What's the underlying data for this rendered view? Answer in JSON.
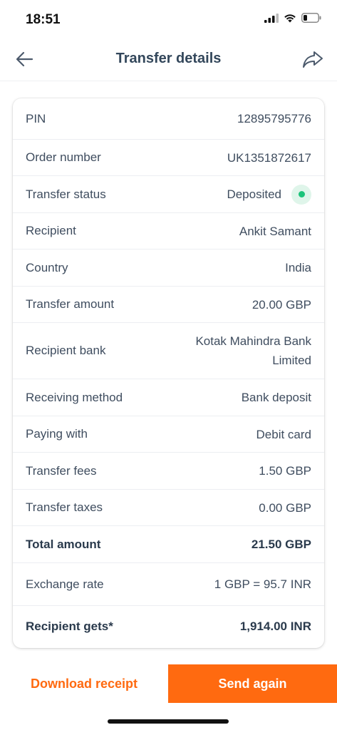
{
  "status_bar": {
    "time": "18:51"
  },
  "nav": {
    "title": "Transfer details"
  },
  "details": {
    "pin_label": "PIN",
    "pin_value": "12895795776",
    "order_label": "Order number",
    "order_value": "UK1351872617",
    "status_label": "Transfer status",
    "status_value": "Deposited",
    "recipient_label": "Recipient",
    "recipient_value": "Ankit Samant",
    "country_label": "Country",
    "country_value": "India",
    "amount_label": "Transfer amount",
    "amount_value": "20.00 GBP",
    "bank_label": "Recipient bank",
    "bank_value_line1": "Kotak Mahindra Bank",
    "bank_value_line2": "Limited",
    "method_label": "Receiving method",
    "method_value": "Bank deposit",
    "paying_label": "Paying with",
    "paying_value": "Debit card",
    "fees_label": "Transfer fees",
    "fees_value": "1.50 GBP",
    "taxes_label": "Transfer taxes",
    "taxes_value": "0.00 GBP",
    "total_label": "Total amount",
    "total_value": "21.50 GBP",
    "rate_label": "Exchange rate",
    "rate_value": "1 GBP = 95.7 INR",
    "gets_label": "Recipient gets*",
    "gets_value": "1,914.00 INR"
  },
  "footer": {
    "download_label": "Download receipt",
    "send_label": "Send again"
  },
  "colors": {
    "accent": "#ff6a10",
    "status_green": "#1cc37a",
    "text": "#3f4d5f"
  }
}
